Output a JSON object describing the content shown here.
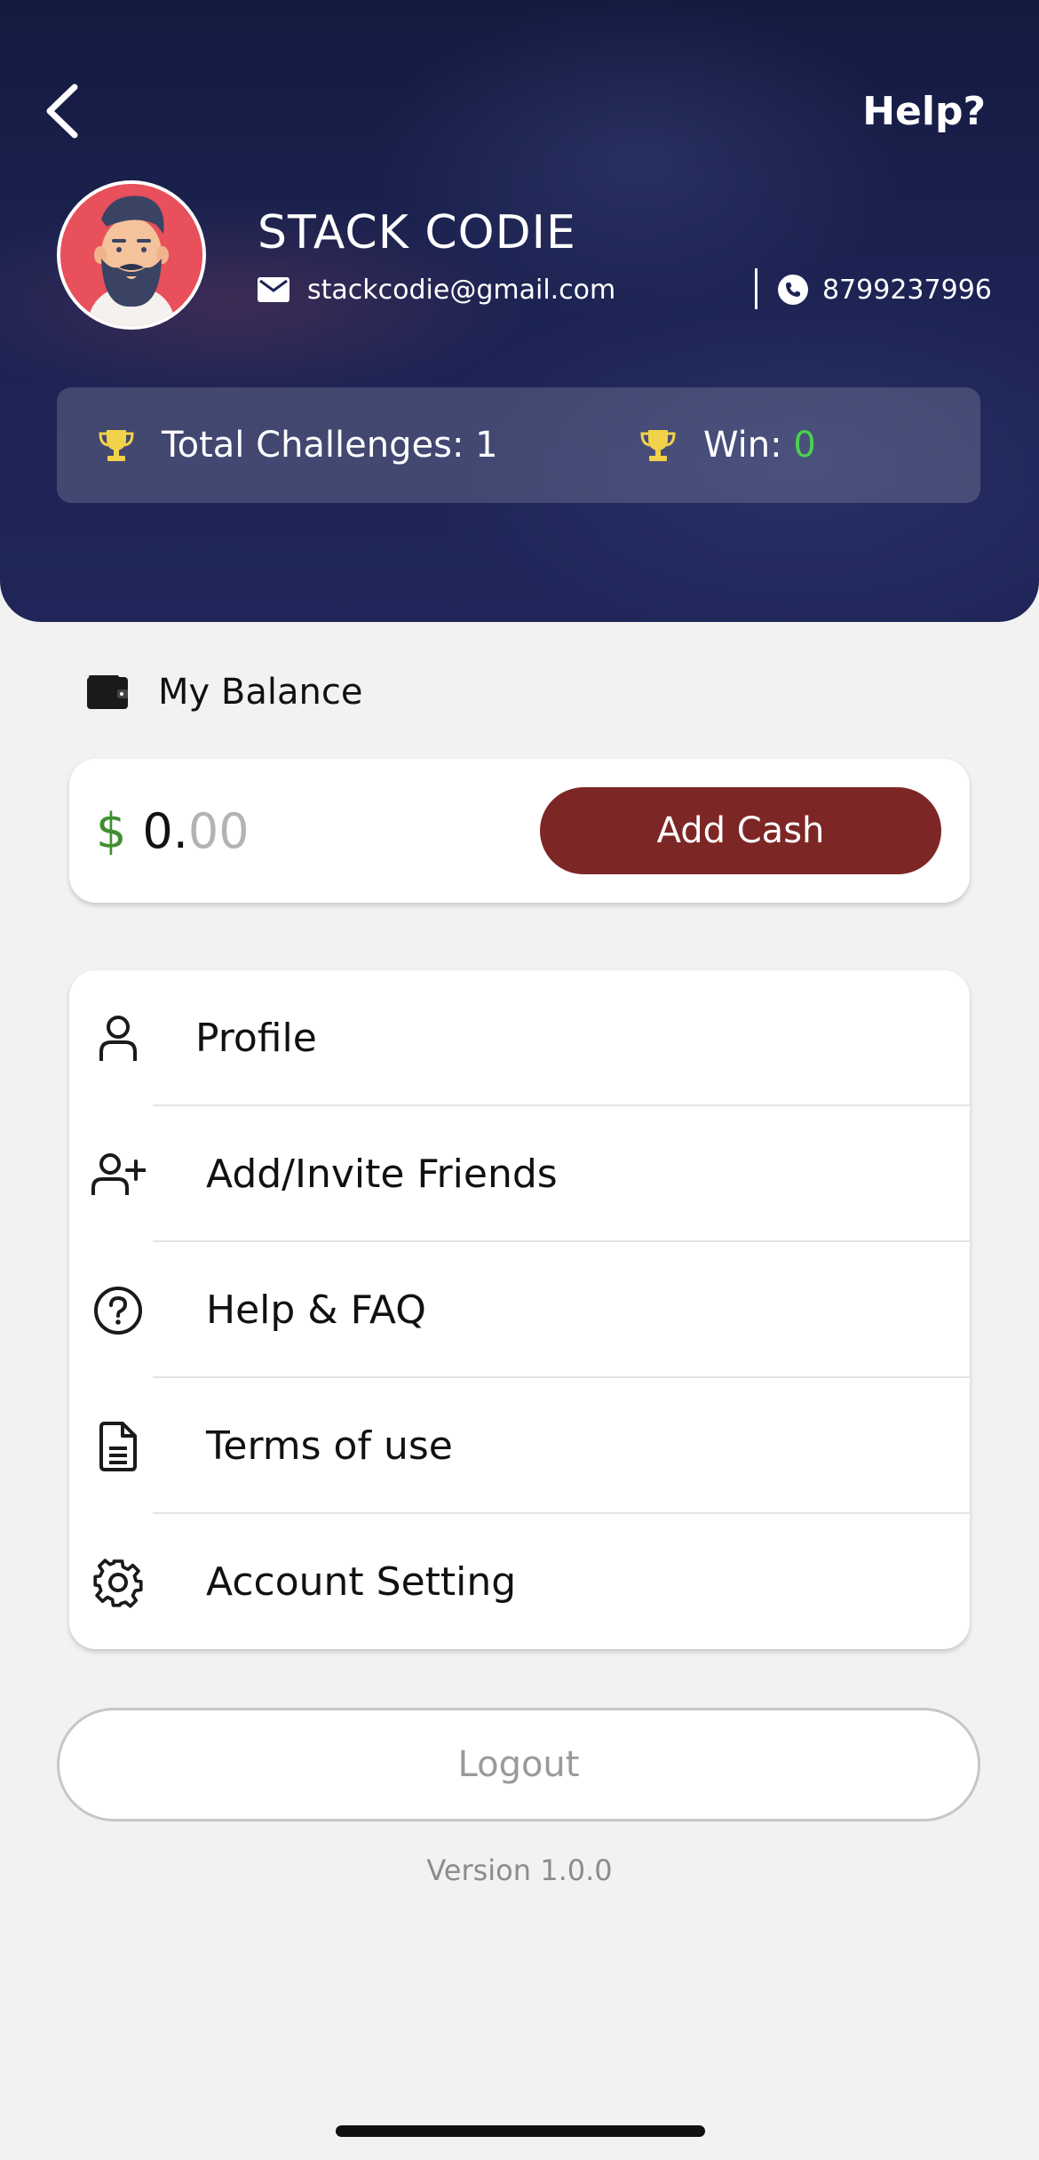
{
  "header": {
    "help_label": "Help?",
    "icons": {
      "back": "chevron-left-icon"
    }
  },
  "user": {
    "name": "STACK CODIE",
    "email": "stackcodie@gmail.com",
    "phone": "8799237996",
    "icons": {
      "email": "mail-icon",
      "phone": "phone-icon",
      "avatar": "bearded-man-avatar"
    }
  },
  "stats": {
    "total_label": "Total Challenges: 1",
    "win_label": "Win: ",
    "win_value": "0",
    "icon": "trophy-icon",
    "colors": {
      "trophy": "#f2d24a",
      "win_value": "#49d14d"
    }
  },
  "balance": {
    "title": "My Balance",
    "currency": "$",
    "amount_int": "0.",
    "amount_dec": "00",
    "add_cash_label": "Add Cash",
    "icon": "wallet-icon",
    "colors": {
      "currency": "#3f8f2f",
      "add_cash_bg": "#7d2626"
    }
  },
  "menu": {
    "items": [
      {
        "label": "Profile",
        "icon": "user-icon"
      },
      {
        "label": "Add/Invite Friends",
        "icon": "user-plus-icon"
      },
      {
        "label": "Help & FAQ",
        "icon": "question-circle-icon"
      },
      {
        "label": "Terms of use",
        "icon": "document-icon"
      },
      {
        "label": "Account Setting",
        "icon": "gear-icon"
      }
    ]
  },
  "footer": {
    "logout_label": "Logout",
    "version": "Version 1.0.0"
  },
  "colors": {
    "header_bg": "#1c2352",
    "page_bg": "#f2f2f2"
  }
}
